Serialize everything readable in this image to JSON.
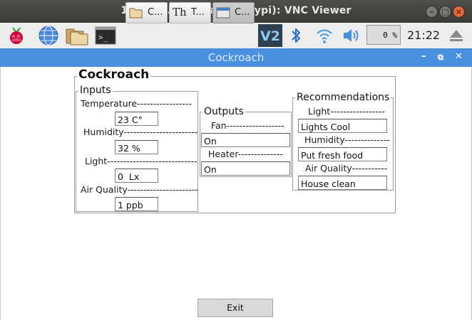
{
  "window": {
    "title": "192.168.0.30 (raspberrypi): VNC Viewer"
  },
  "taskbar": {
    "tasks": [
      {
        "label": "C...",
        "icon": "folder-icon"
      },
      {
        "label": "T...",
        "icon": "font-icon"
      },
      {
        "label": "C...",
        "icon": "app-window-icon"
      }
    ],
    "cpu": "0 %",
    "clock": "21:22"
  },
  "app": {
    "title": "Cockroach",
    "heading": "Cockroach",
    "inputs": {
      "legend": "Inputs",
      "temperature_label": "Temperature-----------------",
      "temperature_value": "23 C°",
      "humidity_label": "Humidity-----------------------",
      "humidity_value": "32 %",
      "light_label": "Light----------------------------",
      "light_value": "0  Lx",
      "air_label": "Air Quality----------------------",
      "air_value": "1 ppb"
    },
    "outputs": {
      "legend": "Outputs",
      "fan_label": "Fan------------------",
      "fan_value": "On",
      "heater_label": "Heater--------------",
      "heater_value": "On"
    },
    "recommendations": {
      "legend": "Recommendations",
      "light_label": "Light-----------------",
      "light_value": "Lights Cool",
      "humidity_label": "Humidity--------------",
      "humidity_value": "Put fresh food",
      "air_label": "Air Quality-----------",
      "air_value": "House clean"
    },
    "exit_label": "Exit"
  }
}
